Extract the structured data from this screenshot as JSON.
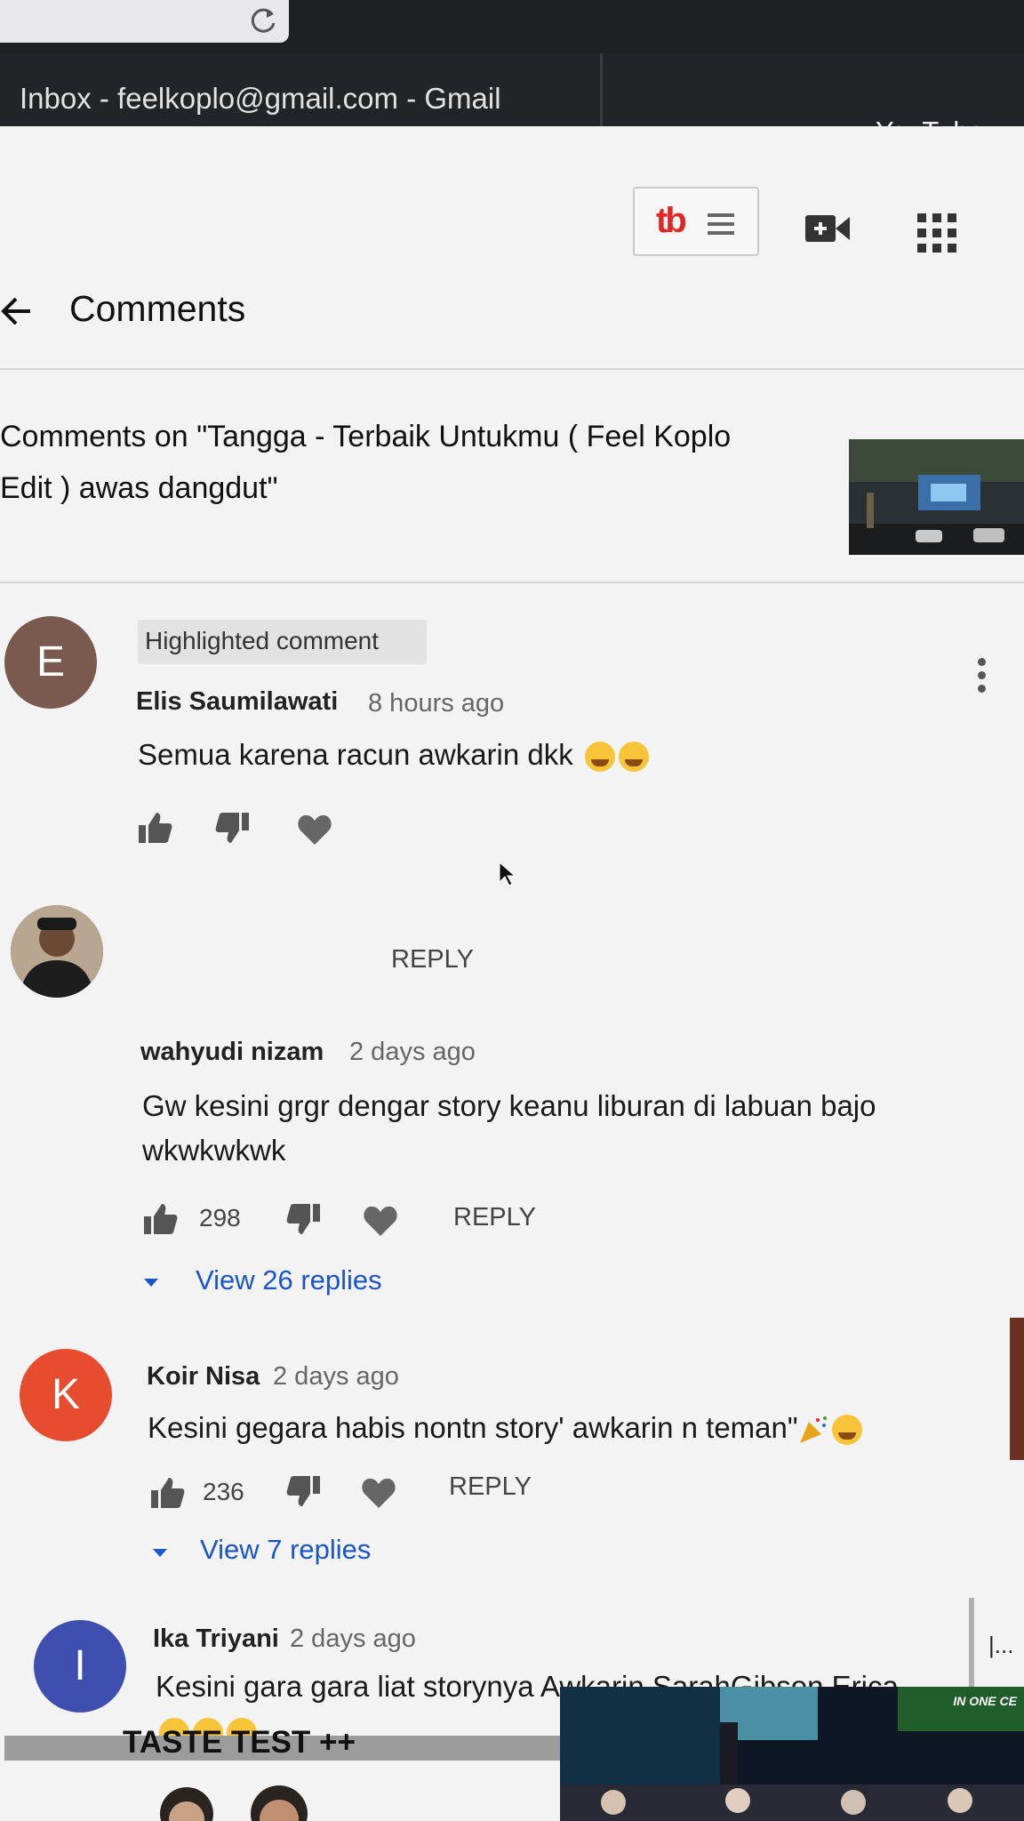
{
  "browser": {
    "tabs": [
      {
        "label": "Inbox - feelkoplo@gmail.com - Gmail"
      },
      {
        "label": "YouTube"
      }
    ]
  },
  "toolbar": {
    "tubebuddy_logo": "tb"
  },
  "icons": {
    "reload": "reload-icon",
    "create": "video-camera-plus-icon",
    "apps": "apps-grid-icon",
    "back": "back-arrow-icon",
    "menu": "more-vertical-icon",
    "like": "thumb-up-icon",
    "dislike": "thumb-down-icon",
    "heart": "heart-icon"
  },
  "header": {
    "title": "Comments"
  },
  "video": {
    "line1": "Comments on \"Tangga - Terbaik Untukmu ( Feel Koplo",
    "line2": "Edit ) awas dangdut\""
  },
  "comments": [
    {
      "badge": "Highlighted comment",
      "avatar_letter": "E",
      "avatar_color": "#7a5a4f",
      "author": "Elis Saumilawati",
      "time": "8 hours ago",
      "text": "Semua karena racun awkarin dkk",
      "likes": "",
      "reply_label": "REPLY"
    },
    {
      "avatar_letter": "",
      "author": "wahyudi nizam",
      "time": "2 days ago",
      "text_line1": "Gw kesini grgr dengar story keanu liburan di labuan bajo",
      "text_line2": "wkwkwkwk",
      "likes": "298",
      "reply_label": "REPLY",
      "view_replies": "View 26 replies"
    },
    {
      "avatar_letter": "K",
      "avatar_color": "#e74c2e",
      "author": "Koir Nisa",
      "time": "2 days ago",
      "text": "Kesini gegara habis nontn story' awkarin n teman\"",
      "likes": "236",
      "reply_label": "REPLY",
      "view_replies": "View 7 replies"
    },
    {
      "avatar_letter": "I",
      "avatar_color": "#3e4fb0",
      "author": "Ika Triyani",
      "time": "2 days ago",
      "text": "Kesini gara gara liat storynya Awkarin,SarahGibson,Erica"
    }
  ],
  "side": {
    "ellipsis": "|..."
  },
  "next_video": {
    "title": "TASTE TEST ++",
    "thumb_caption": "IN ONE CE"
  },
  "colors": {
    "link": "#1b55c9",
    "tubebuddy": "#e32626"
  }
}
